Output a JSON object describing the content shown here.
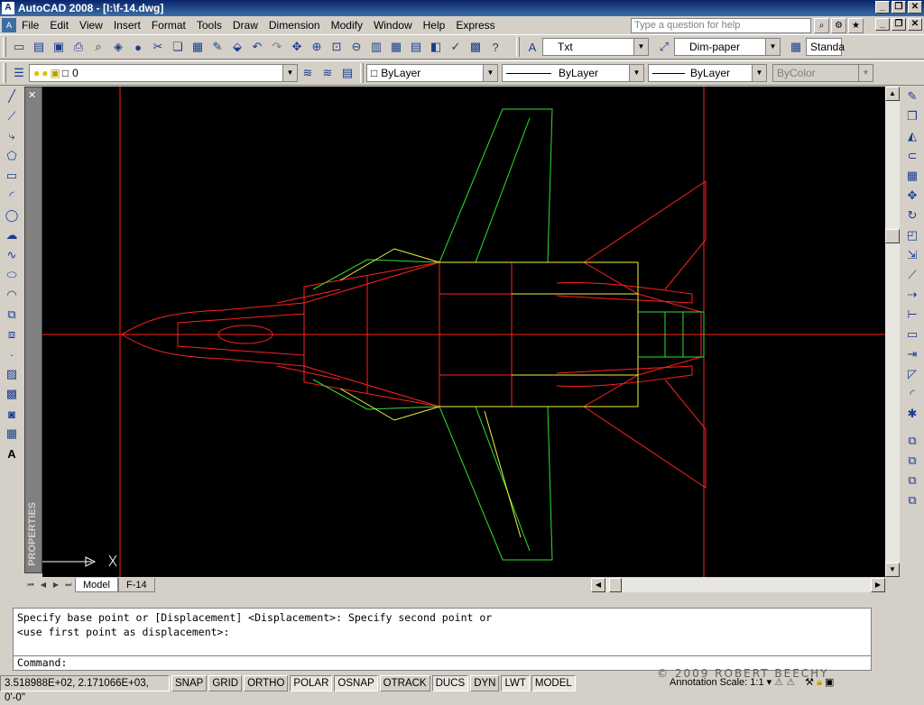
{
  "window": {
    "title": "AutoCAD 2008 - [I:\\f-14.dwg]",
    "app_icon": "autocad-icon"
  },
  "menu": [
    "File",
    "Edit",
    "View",
    "Insert",
    "Format",
    "Tools",
    "Draw",
    "Dimension",
    "Modify",
    "Window",
    "Help",
    "Express"
  ],
  "help": {
    "placeholder": "Type a question for help"
  },
  "toolbar1": {
    "text_style": "Txt",
    "dim_style": "Dim-paper",
    "table_style": "Standa"
  },
  "toolbar2": {
    "layer": "0",
    "color": "ByLayer",
    "linetype": "ByLayer",
    "lineweight": "ByLayer",
    "plotstyle": "ByColor"
  },
  "properties_palette": {
    "label": "PROPERTIES",
    "close": "✕"
  },
  "tabs": {
    "model": "Model",
    "layout": "F-14"
  },
  "command": {
    "line1": "Specify base point or [Displacement] <Displacement>: Specify second point or",
    "line2": "<use first point as displacement>:",
    "prompt": "Command:"
  },
  "status": {
    "coords": "3.518988E+02, 2.171066E+03, 0'-0\"",
    "buttons": [
      "SNAP",
      "GRID",
      "ORTHO",
      "POLAR",
      "OSNAP",
      "OTRACK",
      "DUCS",
      "DYN",
      "LWT",
      "MODEL"
    ],
    "active": [
      "POLAR",
      "OSNAP",
      "DUCS",
      "LWT",
      "MODEL"
    ],
    "annotation_scale_label": "Annotation Scale:",
    "annotation_scale": "1:1"
  },
  "watermark": "© 2009 ROBERT BEECHY",
  "colors": {
    "canvas": "#000000",
    "red": "#ff2020",
    "green": "#30e030",
    "yellow": "#f0f040"
  }
}
